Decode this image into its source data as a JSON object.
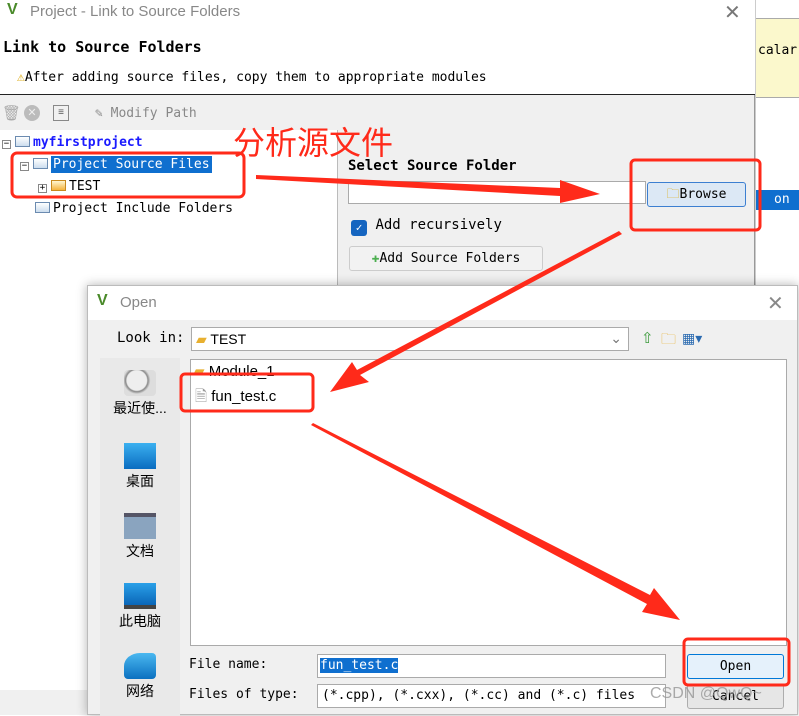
{
  "background_app": {
    "snippet_1": "calar",
    "snippet_2": "on"
  },
  "main_window": {
    "title": "Project - Link to Source Folders",
    "heading": "Link to Source Folders",
    "warning": "After adding source files, copy them to appropriate modules",
    "toolbar": {
      "modify_path_label": "Modify Path"
    },
    "tree": {
      "root": "myfirstproject",
      "items": [
        {
          "label": "Project Source Files",
          "selected": true
        },
        {
          "label": "TEST"
        },
        {
          "label": "Project Include Folders"
        }
      ]
    },
    "select_source_folder_label": "Select Source Folder",
    "source_folder_value": "",
    "browse_label": "Browse",
    "add_recursively_label": "Add recursively",
    "add_recursively_checked": true,
    "add_source_folders_label": "Add Source Folders"
  },
  "open_dialog": {
    "title": "Open",
    "look_in_label": "Look in:",
    "look_in_value": "TEST",
    "places": [
      "最近使...",
      "桌面",
      "文档",
      "此电脑",
      "网络"
    ],
    "files": [
      {
        "name": "Module_1",
        "type": "folder"
      },
      {
        "name": "fun_test.c",
        "type": "file"
      }
    ],
    "file_name_label": "File name:",
    "file_name_value": "fun_test.c",
    "files_of_type_label": "Files of type:",
    "files_of_type_value": "(*.cpp), (*.cxx), (*.cc) and (*.c) files",
    "open_label": "Open",
    "cancel_label": "Cancel"
  },
  "annotation": {
    "text": "分析源文件",
    "color": "#ff2a1a"
  },
  "watermark": "CSDN @QwQ~"
}
